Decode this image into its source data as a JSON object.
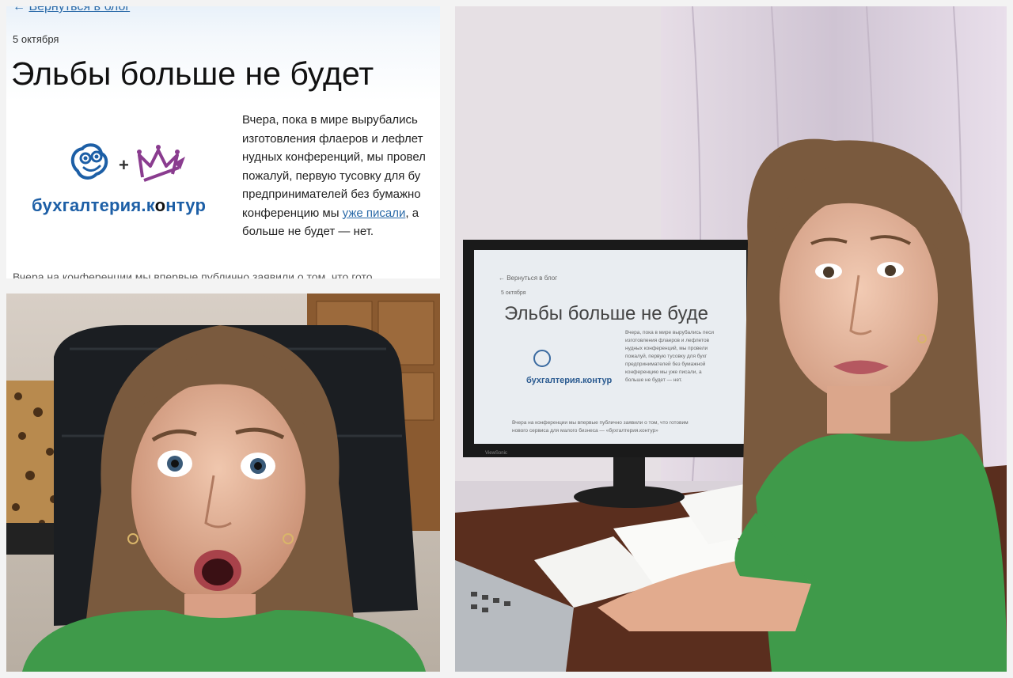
{
  "blog_screenshot": {
    "back_link": "Вернуться в блог",
    "back_arrow": "←",
    "date": "5 октября",
    "title": "Эльбы больше не будет",
    "logo": {
      "text_main": "бухгалтерия.к",
      "text_cloud": "о",
      "text_end": "нтур",
      "plus": "+"
    },
    "body_lines": [
      "Вчера, пока в мире вырубались",
      "изготовления флаеров и лефлет",
      "нудных конференций, мы провел",
      "пожалуй, первую тусовку для бу",
      "предпринимателей без бумажно"
    ],
    "body_line6_before": "конференцию мы ",
    "body_link": "уже писали",
    "body_line6_after": ", а",
    "body_line7": "больше не будет — нет.",
    "footer_line": "Вчера на конференции мы впервые публично заявили о том, что гото"
  },
  "monitor_screen": {
    "back_link": "← Вернуться в блог",
    "date": "5 октября",
    "title": "Эльбы больше не буде",
    "logo_text": "бухгалтерия.контур",
    "body_lines": [
      "Вчера, пока в мире вырубались песи",
      "изготовления флаеров и лефлетов",
      "нудных конференций, мы провели",
      "пожалуй, первую тусовку для бухг",
      "предпринимателей без бумажной",
      "конференцию мы уже писали, а",
      "больше не будет — нет."
    ],
    "footer_lines": [
      "Вчера на конференции мы впервые публично заявили о том, что готовим",
      "нового сервиса для малого бизнеса — «бухгалтерия.контур»"
    ],
    "brand": "ViewSonic"
  },
  "colors": {
    "link": "#2a6aa8",
    "shirt_green": "#3f9a4a",
    "hair": "#7a5a3e",
    "skin": "#e8b9a0"
  }
}
